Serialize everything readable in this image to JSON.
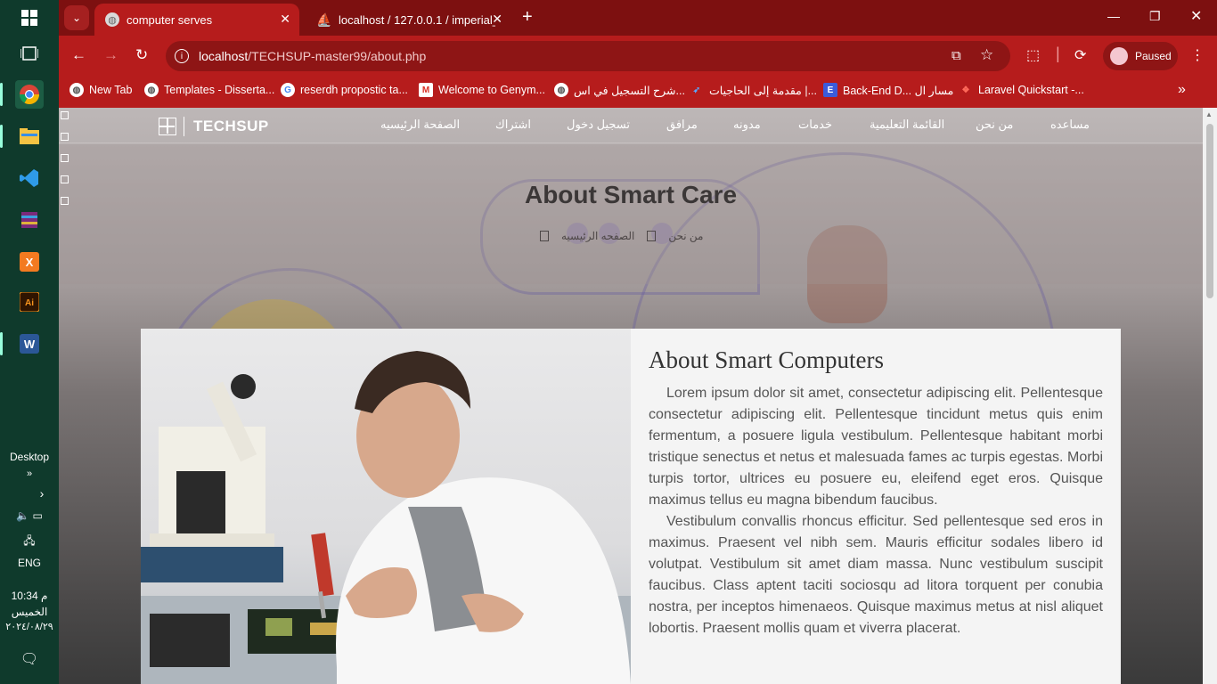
{
  "taskbar": {
    "desktop_label": "Desktop",
    "language": "ENG",
    "time": "10:34 م",
    "day": "الخميس",
    "date": "٢٠٢٤/٠٨/٢٩"
  },
  "browser": {
    "tabs": [
      {
        "title": "computer serves",
        "active": true
      },
      {
        "title": "localhost / 127.0.0.1 / imperial_",
        "active": false
      }
    ],
    "address": {
      "host": "localhost",
      "path": "/TECHSUP-master99/about.php"
    },
    "profile_status": "Paused",
    "bookmarks": [
      {
        "label": "New Tab"
      },
      {
        "label": "Templates - Disserta..."
      },
      {
        "label": "reserdh propostic ta..."
      },
      {
        "label": "Welcome to Genym..."
      },
      {
        "label": "شرح التسجيل في اس..."
      },
      {
        "label": "مقدمة إلى الحاجيات |..."
      },
      {
        "label": "Back-End D... مسار ال"
      },
      {
        "label": "Laravel Quickstart -..."
      }
    ]
  },
  "site": {
    "logo_text": "TECHSUP",
    "nav": [
      "الصفحة الرئيسيه",
      "اشتراك",
      "تسجيل دخول",
      "مرافق",
      "مدونه",
      "خدمات",
      "القائمة التعليمية",
      "من نحن",
      "مساعده"
    ],
    "hero_title": "About Smart Care",
    "breadcrumb": {
      "home": "الصفحه الرئيسيه",
      "current": "من نحن"
    },
    "about": {
      "title": "About Smart Computers",
      "paragraphs": [
        "Lorem ipsum dolor sit amet, consectetur adipiscing elit. Pellentesque consectetur adipiscing elit. Pellentesque tincidunt metus quis enim fermentum, a posuere ligula vestibulum. Pellentesque habitant morbi tristique senectus et netus et malesuada fames ac turpis egestas. Morbi turpis tortor, ultrices eu posuere eu, eleifend eget eros. Quisque maximus tellus eu magna bibendum faucibus.",
        "Vestibulum convallis rhoncus efficitur. Sed pellentesque sed eros in maximus. Praesent vel nibh sem. Mauris efficitur sodales libero id volutpat. Vestibulum sit amet diam massa. Nunc vestibulum suscipit faucibus. Class aptent taciti sociosqu ad litora torquent per conubia nostra, per inceptos himenaeos. Quisque maximus metus at nisl aliquet lobortis. Praesent mollis quam et viverra placerat."
      ]
    }
  },
  "colors": {
    "tabstrip": "#7d1010",
    "toolbar": "#b61c1c",
    "taskbar": "#0f3a2c"
  }
}
